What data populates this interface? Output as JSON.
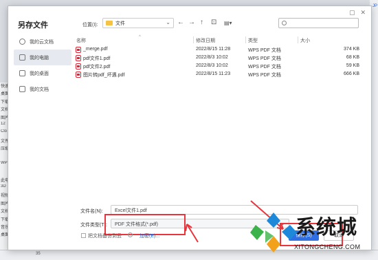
{
  "background": {
    "left_strip": [
      "快速",
      "桌面",
      "下载",
      "文档",
      "图片",
      "12",
      "Clo",
      "文件",
      "压缩",
      "",
      "WPS",
      "",
      "此电",
      "3D",
      "视频",
      "图片",
      "文档",
      "下载",
      "音乐",
      "桌面"
    ],
    "bottom_cell": "35",
    "right_tag": "JP"
  },
  "dialog": {
    "title": "另存文件",
    "window_controls": [
      "▢",
      "✕"
    ],
    "sidebar": [
      {
        "label": "我的云文档",
        "icon": "cloud-icon"
      },
      {
        "label": "我的电脑",
        "icon": "computer-icon",
        "active": true
      },
      {
        "label": "我的桌面",
        "icon": "desktop-icon"
      },
      {
        "label": "我的文档",
        "icon": "document-icon"
      }
    ],
    "location": {
      "label": "位置(I):",
      "value": "文件"
    },
    "nav": {
      "back": "←",
      "forward": "→",
      "up": "↑",
      "new_folder": "⊡",
      "view": "▤▾"
    },
    "search": {
      "placeholder": ""
    },
    "columns": {
      "name": "名称",
      "modified": "修改日期",
      "type": "类型",
      "size": "大小"
    },
    "files": [
      {
        "name": "_merge.pdf",
        "modified": "2022/8/15 11:28",
        "type": "WPS PDF 文档",
        "size": "374 KB"
      },
      {
        "name": "pdf文件1.pdf",
        "modified": "2022/8/3 10:02",
        "type": "WPS PDF 文档",
        "size": "68 KB"
      },
      {
        "name": "pdf文件2.pdf",
        "modified": "2022/8/3 10:02",
        "type": "WPS PDF 文档",
        "size": "59 KB"
      },
      {
        "name": "图片转pdf_坏遇.pdf",
        "modified": "2022/8/15 11:23",
        "type": "WPS PDF 文档",
        "size": "666 KB"
      }
    ],
    "filename": {
      "label": "文件名(N):",
      "value": "Excel文件1.pdf"
    },
    "filetype": {
      "label": "文件类型(T):",
      "value": "PDF 文件格式(*.pdf)"
    },
    "backup": {
      "label": "把文档备份到云",
      "info": "i"
    },
    "encrypt": "加密(E)...",
    "save": "保存(S)",
    "cancel": "取消"
  },
  "watermark": {
    "title": "系统城",
    "subtitle": "XITONGCHENG.COM"
  },
  "colors": {
    "accent": "#2f6fe3",
    "highlight": "#e8343b",
    "folder": "#f5c344"
  }
}
